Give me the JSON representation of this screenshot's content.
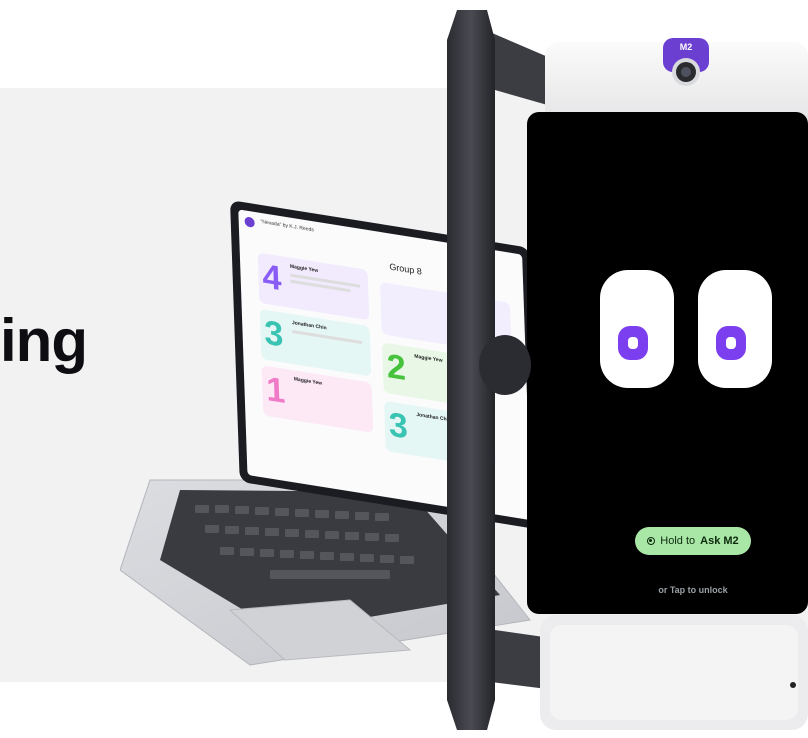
{
  "headline": "ing",
  "laptop_ui": {
    "header_chip": "\"Nevada\" by K.J. Reeds",
    "group_title": "Group 8",
    "cards": [
      {
        "rank": "4",
        "name": "Maggie Yew"
      },
      {
        "rank": "3",
        "name": "Jonathan Chin"
      },
      {
        "rank": "1",
        "name": "Maggie Yew"
      },
      {
        "rank": "2",
        "name": "Maggie Yew"
      },
      {
        "rank": "3",
        "name": "Jonathan Chin"
      }
    ]
  },
  "device": {
    "badge": "M2",
    "primary_button": {
      "prefix": "Hold to ",
      "emphasis": "Ask M2"
    },
    "secondary_link": "or Tap to unlock"
  },
  "colors": {
    "accent": "#7b3ff0",
    "button_green": "#a9e7a6",
    "screen": "#000000"
  }
}
